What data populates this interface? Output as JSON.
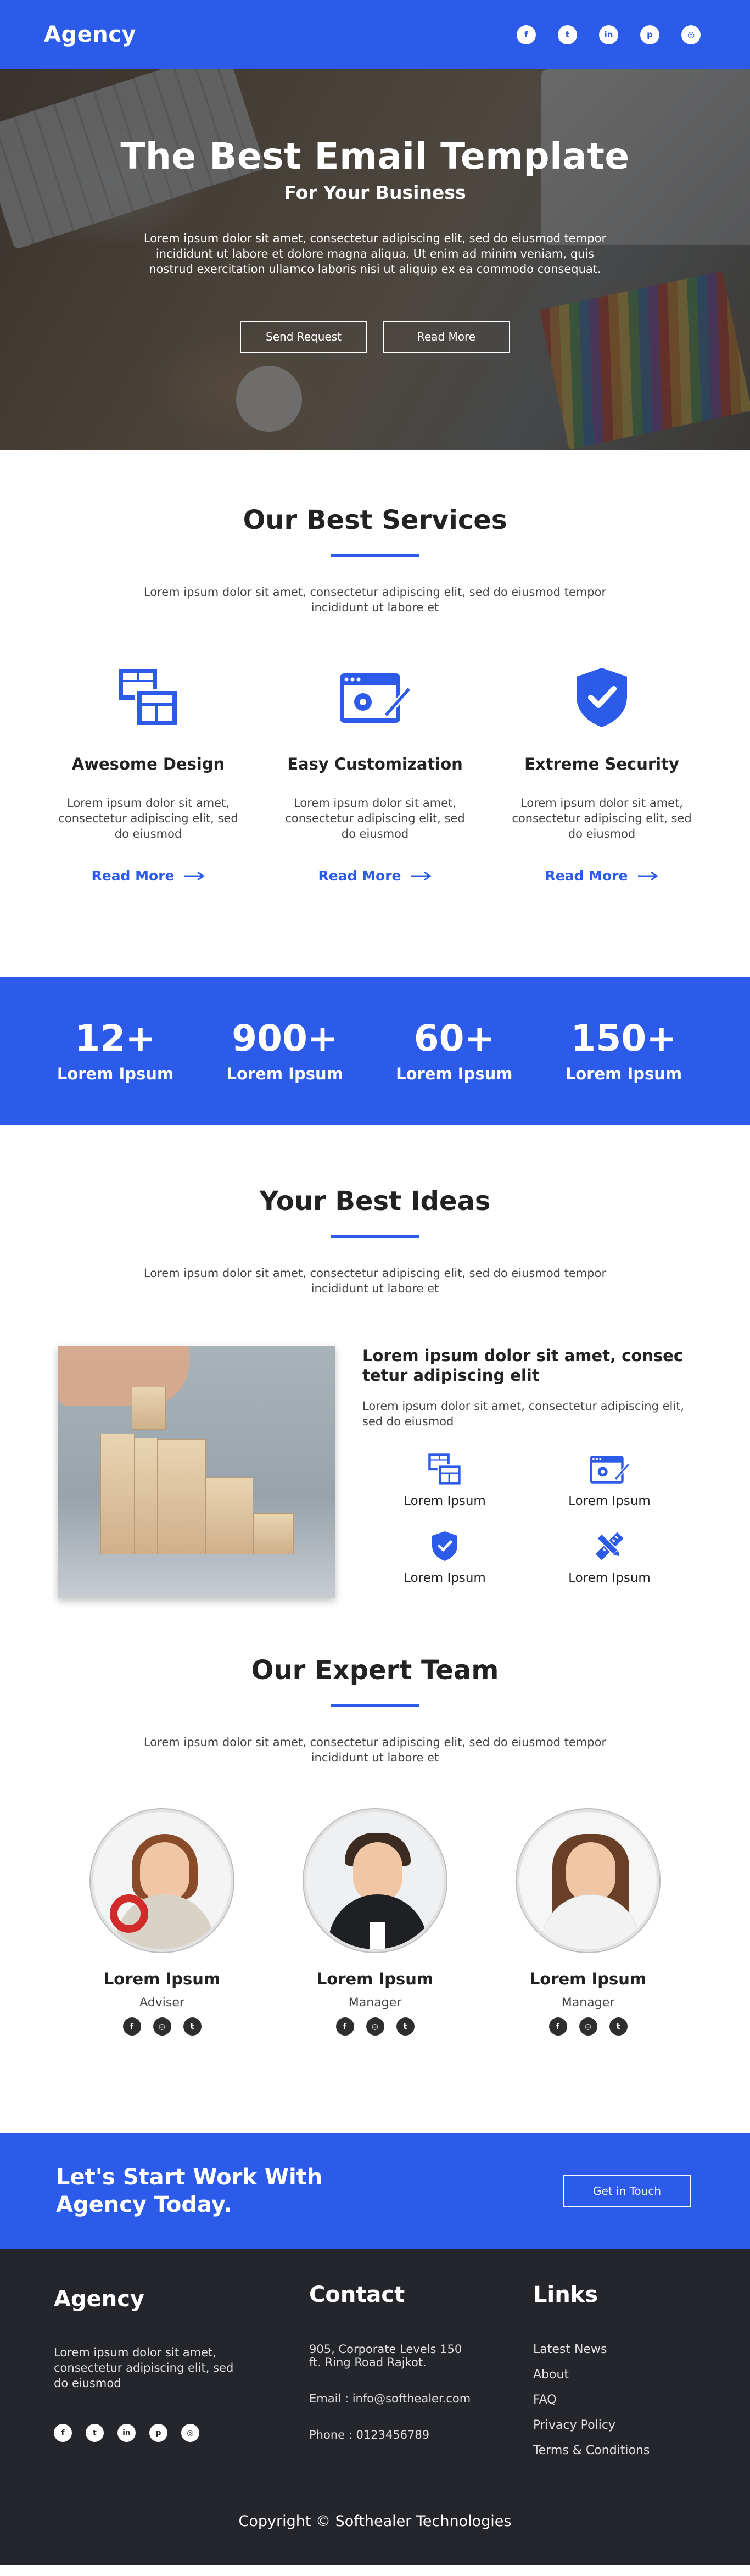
{
  "header": {
    "brand": "Agency",
    "social": [
      {
        "icon": "facebook-icon",
        "glyph": "f"
      },
      {
        "icon": "twitter-icon",
        "glyph": "t"
      },
      {
        "icon": "linkedin-icon",
        "glyph": "in"
      },
      {
        "icon": "pinterest-icon",
        "glyph": "p"
      },
      {
        "icon": "instagram-icon",
        "glyph": "◎"
      }
    ]
  },
  "hero": {
    "title": "The Best Email Template",
    "subtitle": "For Your Business",
    "text": "Lorem ipsum dolor sit amet, consectetur adipiscing elit, sed do eiusmod tempor incididunt ut labore et dolore magna aliqua. Ut enim ad minim veniam, quis nostrud exercitation ullamco laboris nisi ut aliquip ex ea commodo consequat.",
    "btn_primary": "Send Request",
    "btn_secondary": "Read More"
  },
  "services": {
    "title": "Our Best Services",
    "desc": "Lorem ipsum dolor sit amet, consectetur adipiscing elit, sed do eiusmod tempor incididunt ut labore et",
    "items": [
      {
        "icon": "layout-design-icon",
        "title": "Awesome Design",
        "text": "Lorem ipsum dolor sit amet, consectetur adipiscing elit, sed do eiusmod",
        "link": "Read More"
      },
      {
        "icon": "browser-settings-icon",
        "title": "Easy Customization",
        "text": "Lorem ipsum dolor sit amet, consectetur adipiscing elit, sed do eiusmod",
        "link": "Read More"
      },
      {
        "icon": "shield-check-icon",
        "title": "Extreme Security",
        "text": "Lorem ipsum dolor sit amet, consectetur adipiscing elit, sed do eiusmod",
        "link": "Read More"
      }
    ]
  },
  "stats": [
    {
      "num": "12+",
      "label": "Lorem Ipsum"
    },
    {
      "num": "900+",
      "label": "Lorem Ipsum"
    },
    {
      "num": "60+",
      "label": "Lorem Ipsum"
    },
    {
      "num": "150+",
      "label": "Lorem Ipsum"
    }
  ],
  "ideas": {
    "title": "Your Best Ideas",
    "desc": "Lorem ipsum dolor sit amet, consectetur adipiscing elit, sed do eiusmod tempor incididunt ut labore et",
    "heading": "Lorem ipsum dolor sit amet, consec tetur adipiscing elit",
    "text": "Lorem ipsum dolor sit amet, consectetur adipiscing elit, sed do eiusmod",
    "features": [
      {
        "icon": "layout-design-icon",
        "label": "Lorem Ipsum"
      },
      {
        "icon": "browser-settings-icon",
        "label": "Lorem Ipsum"
      },
      {
        "icon": "shield-check-icon",
        "label": "Lorem Ipsum"
      },
      {
        "icon": "pencil-ruler-icon",
        "label": "Lorem Ipsum"
      }
    ]
  },
  "team": {
    "title": "Our Expert Team",
    "desc": "Lorem ipsum dolor sit amet, consectetur adipiscing elit, sed do eiusmod tempor incididunt ut labore et",
    "members": [
      {
        "name": "Lorem Ipsum",
        "role": "Adviser"
      },
      {
        "name": "Lorem Ipsum",
        "role": "Manager"
      },
      {
        "name": "Lorem Ipsum",
        "role": "Manager"
      }
    ]
  },
  "cta": {
    "text": "Let's Start Work With Agency Today.",
    "button": "Get in Touch"
  },
  "footer": {
    "brand": "Agency",
    "about": "Lorem ipsum dolor sit amet, consectetur adipiscing elit, sed do eiusmod",
    "contact_title": "Contact",
    "address": "905, Corporate Levels 150 ft. Ring Road Rajkot.",
    "email": "Email : info@softhealer.com",
    "phone": "Phone : 0123456789",
    "links_title": "Links",
    "links": [
      "Latest News",
      "About",
      "FAQ",
      "Privacy Policy",
      "Terms & Conditions"
    ],
    "copyright": "Copyright © Softhealer Technologies"
  },
  "colors": {
    "accent": "#2c5bea",
    "footer_bg": "#24262b"
  }
}
